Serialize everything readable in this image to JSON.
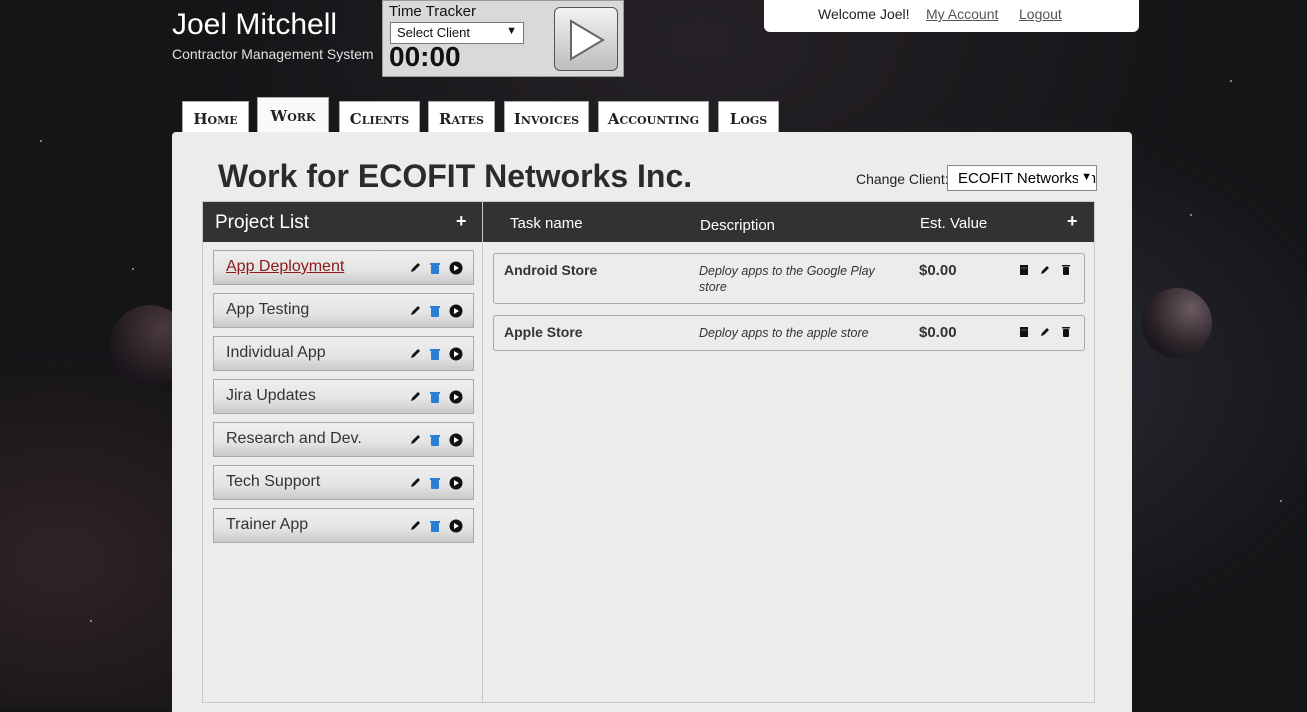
{
  "header": {
    "title": "Joel Mitchell",
    "subtitle": "Contractor Management System"
  },
  "tracker": {
    "label": "Time Tracker",
    "select_value": "Select Client",
    "time": "00:00"
  },
  "account": {
    "welcome": "Welcome Joel!",
    "my_account": "My Account",
    "logout": "Logout"
  },
  "tabs": [
    {
      "label": "Home",
      "active": false
    },
    {
      "label": "Work",
      "active": true
    },
    {
      "label": "Clients",
      "active": false
    },
    {
      "label": "Rates",
      "active": false
    },
    {
      "label": "Invoices",
      "active": false
    },
    {
      "label": "Accounting",
      "active": false
    },
    {
      "label": "Logs",
      "active": false
    }
  ],
  "main": {
    "title": "Work for ECOFIT Networks Inc.",
    "change_client_label": "Change Client:",
    "change_client_value": "ECOFIT Networks Inc."
  },
  "projects": {
    "heading": "Project List",
    "items": [
      {
        "name": "App Deployment",
        "selected": true
      },
      {
        "name": "App Testing",
        "selected": false
      },
      {
        "name": "Individual App",
        "selected": false
      },
      {
        "name": "Jira Updates",
        "selected": false
      },
      {
        "name": "Research and Dev.",
        "selected": false
      },
      {
        "name": "Tech Support",
        "selected": false
      },
      {
        "name": "Trainer App",
        "selected": false
      }
    ]
  },
  "tasks": {
    "columns": {
      "name": "Task name",
      "description": "Description",
      "value": "Est. Value"
    },
    "rows": [
      {
        "name": "Android Store",
        "description": "Deploy apps to the Google Play store",
        "value": "$0.00"
      },
      {
        "name": "Apple Store",
        "description": "Deploy apps to the apple store",
        "value": "$0.00"
      }
    ]
  },
  "colors": {
    "panel_bg": "#ececec",
    "header_bar": "#323232",
    "selected_link": "#8b1a1a",
    "trash_icon": "#2a7fd4"
  }
}
